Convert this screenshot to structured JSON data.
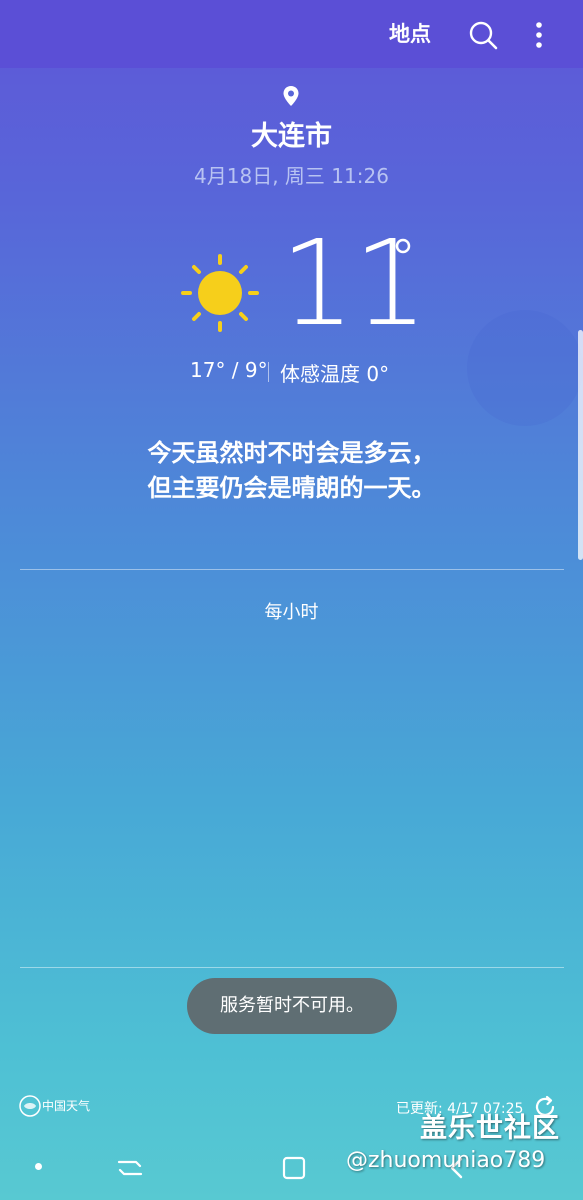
{
  "toolbar": {
    "locations_label": "地点",
    "search_icon": "search-icon",
    "more_icon": "more-vertical-icon"
  },
  "current": {
    "city": "大连市",
    "datetime": "4月18日, 周三 11:26",
    "temperature": "11",
    "temp_unit": "°",
    "high_low": "17° / 9°",
    "feels_like": "体感温度 0°",
    "condition_icon": "sun-icon"
  },
  "summary": {
    "line1": "今天虽然时不时会是多云，",
    "line2": "但主要仍会是晴朗的一天。"
  },
  "hourly": {
    "title": "每小时"
  },
  "toast": {
    "message": "服务暂时不可用。"
  },
  "footer": {
    "provider": "中国天气",
    "updated": "已更新: 4/17 07:25",
    "refresh_icon": "refresh-icon"
  },
  "watermark": {
    "main": "盖乐世社区",
    "sub": "@zhuomuniao789"
  },
  "colors": {
    "toolbar_bg": "#5b4fd6",
    "sun": "#f6cf1b",
    "toast_bg": "#5f6e73",
    "text": "#ffffff",
    "datetime": "#b8c3f2"
  }
}
